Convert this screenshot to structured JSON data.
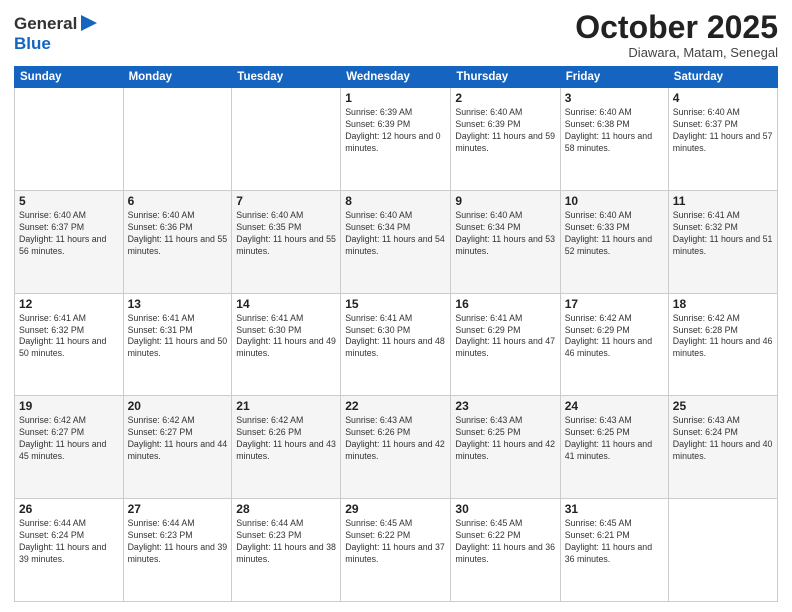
{
  "logo": {
    "general": "General",
    "blue": "Blue"
  },
  "header": {
    "month": "October 2025",
    "location": "Diawara, Matam, Senegal"
  },
  "weekdays": [
    "Sunday",
    "Monday",
    "Tuesday",
    "Wednesday",
    "Thursday",
    "Friday",
    "Saturday"
  ],
  "weeks": [
    [
      {
        "day": "",
        "sunrise": "",
        "sunset": "",
        "daylight": ""
      },
      {
        "day": "",
        "sunrise": "",
        "sunset": "",
        "daylight": ""
      },
      {
        "day": "",
        "sunrise": "",
        "sunset": "",
        "daylight": ""
      },
      {
        "day": "1",
        "sunrise": "Sunrise: 6:39 AM",
        "sunset": "Sunset: 6:39 PM",
        "daylight": "Daylight: 12 hours and 0 minutes."
      },
      {
        "day": "2",
        "sunrise": "Sunrise: 6:40 AM",
        "sunset": "Sunset: 6:39 PM",
        "daylight": "Daylight: 11 hours and 59 minutes."
      },
      {
        "day": "3",
        "sunrise": "Sunrise: 6:40 AM",
        "sunset": "Sunset: 6:38 PM",
        "daylight": "Daylight: 11 hours and 58 minutes."
      },
      {
        "day": "4",
        "sunrise": "Sunrise: 6:40 AM",
        "sunset": "Sunset: 6:37 PM",
        "daylight": "Daylight: 11 hours and 57 minutes."
      }
    ],
    [
      {
        "day": "5",
        "sunrise": "Sunrise: 6:40 AM",
        "sunset": "Sunset: 6:37 PM",
        "daylight": "Daylight: 11 hours and 56 minutes."
      },
      {
        "day": "6",
        "sunrise": "Sunrise: 6:40 AM",
        "sunset": "Sunset: 6:36 PM",
        "daylight": "Daylight: 11 hours and 55 minutes."
      },
      {
        "day": "7",
        "sunrise": "Sunrise: 6:40 AM",
        "sunset": "Sunset: 6:35 PM",
        "daylight": "Daylight: 11 hours and 55 minutes."
      },
      {
        "day": "8",
        "sunrise": "Sunrise: 6:40 AM",
        "sunset": "Sunset: 6:34 PM",
        "daylight": "Daylight: 11 hours and 54 minutes."
      },
      {
        "day": "9",
        "sunrise": "Sunrise: 6:40 AM",
        "sunset": "Sunset: 6:34 PM",
        "daylight": "Daylight: 11 hours and 53 minutes."
      },
      {
        "day": "10",
        "sunrise": "Sunrise: 6:40 AM",
        "sunset": "Sunset: 6:33 PM",
        "daylight": "Daylight: 11 hours and 52 minutes."
      },
      {
        "day": "11",
        "sunrise": "Sunrise: 6:41 AM",
        "sunset": "Sunset: 6:32 PM",
        "daylight": "Daylight: 11 hours and 51 minutes."
      }
    ],
    [
      {
        "day": "12",
        "sunrise": "Sunrise: 6:41 AM",
        "sunset": "Sunset: 6:32 PM",
        "daylight": "Daylight: 11 hours and 50 minutes."
      },
      {
        "day": "13",
        "sunrise": "Sunrise: 6:41 AM",
        "sunset": "Sunset: 6:31 PM",
        "daylight": "Daylight: 11 hours and 50 minutes."
      },
      {
        "day": "14",
        "sunrise": "Sunrise: 6:41 AM",
        "sunset": "Sunset: 6:30 PM",
        "daylight": "Daylight: 11 hours and 49 minutes."
      },
      {
        "day": "15",
        "sunrise": "Sunrise: 6:41 AM",
        "sunset": "Sunset: 6:30 PM",
        "daylight": "Daylight: 11 hours and 48 minutes."
      },
      {
        "day": "16",
        "sunrise": "Sunrise: 6:41 AM",
        "sunset": "Sunset: 6:29 PM",
        "daylight": "Daylight: 11 hours and 47 minutes."
      },
      {
        "day": "17",
        "sunrise": "Sunrise: 6:42 AM",
        "sunset": "Sunset: 6:29 PM",
        "daylight": "Daylight: 11 hours and 46 minutes."
      },
      {
        "day": "18",
        "sunrise": "Sunrise: 6:42 AM",
        "sunset": "Sunset: 6:28 PM",
        "daylight": "Daylight: 11 hours and 46 minutes."
      }
    ],
    [
      {
        "day": "19",
        "sunrise": "Sunrise: 6:42 AM",
        "sunset": "Sunset: 6:27 PM",
        "daylight": "Daylight: 11 hours and 45 minutes."
      },
      {
        "day": "20",
        "sunrise": "Sunrise: 6:42 AM",
        "sunset": "Sunset: 6:27 PM",
        "daylight": "Daylight: 11 hours and 44 minutes."
      },
      {
        "day": "21",
        "sunrise": "Sunrise: 6:42 AM",
        "sunset": "Sunset: 6:26 PM",
        "daylight": "Daylight: 11 hours and 43 minutes."
      },
      {
        "day": "22",
        "sunrise": "Sunrise: 6:43 AM",
        "sunset": "Sunset: 6:26 PM",
        "daylight": "Daylight: 11 hours and 42 minutes."
      },
      {
        "day": "23",
        "sunrise": "Sunrise: 6:43 AM",
        "sunset": "Sunset: 6:25 PM",
        "daylight": "Daylight: 11 hours and 42 minutes."
      },
      {
        "day": "24",
        "sunrise": "Sunrise: 6:43 AM",
        "sunset": "Sunset: 6:25 PM",
        "daylight": "Daylight: 11 hours and 41 minutes."
      },
      {
        "day": "25",
        "sunrise": "Sunrise: 6:43 AM",
        "sunset": "Sunset: 6:24 PM",
        "daylight": "Daylight: 11 hours and 40 minutes."
      }
    ],
    [
      {
        "day": "26",
        "sunrise": "Sunrise: 6:44 AM",
        "sunset": "Sunset: 6:24 PM",
        "daylight": "Daylight: 11 hours and 39 minutes."
      },
      {
        "day": "27",
        "sunrise": "Sunrise: 6:44 AM",
        "sunset": "Sunset: 6:23 PM",
        "daylight": "Daylight: 11 hours and 39 minutes."
      },
      {
        "day": "28",
        "sunrise": "Sunrise: 6:44 AM",
        "sunset": "Sunset: 6:23 PM",
        "daylight": "Daylight: 11 hours and 38 minutes."
      },
      {
        "day": "29",
        "sunrise": "Sunrise: 6:45 AM",
        "sunset": "Sunset: 6:22 PM",
        "daylight": "Daylight: 11 hours and 37 minutes."
      },
      {
        "day": "30",
        "sunrise": "Sunrise: 6:45 AM",
        "sunset": "Sunset: 6:22 PM",
        "daylight": "Daylight: 11 hours and 36 minutes."
      },
      {
        "day": "31",
        "sunrise": "Sunrise: 6:45 AM",
        "sunset": "Sunset: 6:21 PM",
        "daylight": "Daylight: 11 hours and 36 minutes."
      },
      {
        "day": "",
        "sunrise": "",
        "sunset": "",
        "daylight": ""
      }
    ]
  ]
}
